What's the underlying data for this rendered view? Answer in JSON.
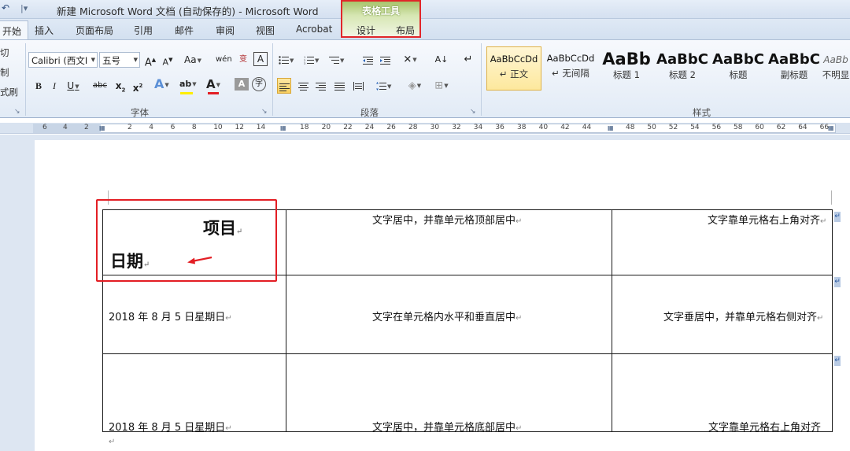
{
  "window": {
    "title": "新建 Microsoft Word 文档 (自动保存的)  -  Microsoft Word",
    "qat_icon": "undo-icon",
    "qat_separator": "|▾"
  },
  "context_group": {
    "title": "表格工具",
    "tabs": [
      "设计",
      "布局"
    ],
    "highlight_color": "#e1262a"
  },
  "ribbon_tabs": [
    "开始",
    "插入",
    "页面布局",
    "引用",
    "邮件",
    "审阅",
    "视图",
    "Acrobat"
  ],
  "clipboard": {
    "items": [
      "切",
      "制",
      "式刷"
    ],
    "label": "↘"
  },
  "font_group": {
    "font_name": "Calibri (西文I",
    "font_size": "五号",
    "grow": "A",
    "shrink": "A",
    "case": "Aa",
    "phonetic": "wén",
    "char_border": "A",
    "bold": "B",
    "italic": "I",
    "underline": "U",
    "strike": "abc",
    "subscript": "x",
    "superscript": "x",
    "effects": "A",
    "highlight": "ab",
    "font_color": "A",
    "char_shading": "A",
    "enclose": "字",
    "label": "字体"
  },
  "paragraph_group": {
    "label": "段落",
    "sort": "A↓",
    "show_marks": "↵"
  },
  "styles_group": {
    "label": "样式",
    "items": [
      {
        "sample": "AaBbCcDd",
        "name": "↵ 正文"
      },
      {
        "sample": "AaBbCcDd",
        "name": "↵ 无间隔"
      },
      {
        "sample": "AaBb",
        "name": "标题 1"
      },
      {
        "sample": "AaBbC",
        "name": "标题 2"
      },
      {
        "sample": "AaBbC",
        "name": "标题"
      },
      {
        "sample": "AaBbC",
        "name": "副标题"
      },
      {
        "sample": "AaBb",
        "name": "不明显"
      }
    ]
  },
  "ruler": {
    "left_numbers": [
      "6",
      "4",
      "2"
    ],
    "numbers": [
      "2",
      "4",
      "6",
      "8",
      "10",
      "12",
      "14",
      "18",
      "20",
      "22",
      "24",
      "26",
      "28",
      "30",
      "32",
      "34",
      "36",
      "38",
      "40",
      "42",
      "44",
      "48",
      "50",
      "52",
      "54",
      "56",
      "58",
      "60",
      "62",
      "64",
      "66"
    ]
  },
  "table": {
    "header_cell": {
      "line1": "项目",
      "line2": "日期"
    },
    "rows": [
      {
        "c1": "",
        "c2": "文字居中，并靠单元格顶部居中",
        "c3": "文字靠单元格右上角对齐"
      },
      {
        "c1": "2018 年 8 月 5 日星期日",
        "c2": "文字在单元格内水平和垂直居中",
        "c3": "文字垂居中，并靠单元格右侧对齐"
      },
      {
        "c1": "2018 年 8 月 5 日星期日",
        "c2": "文字居中，并靠单元格底部居中",
        "c3": "文字靠单元格右上角对齐"
      }
    ],
    "para_mark": "↵",
    "end_mark": "↵"
  },
  "annotation": {
    "box_color": "#e31e24",
    "arrow_color": "#e31e24"
  }
}
